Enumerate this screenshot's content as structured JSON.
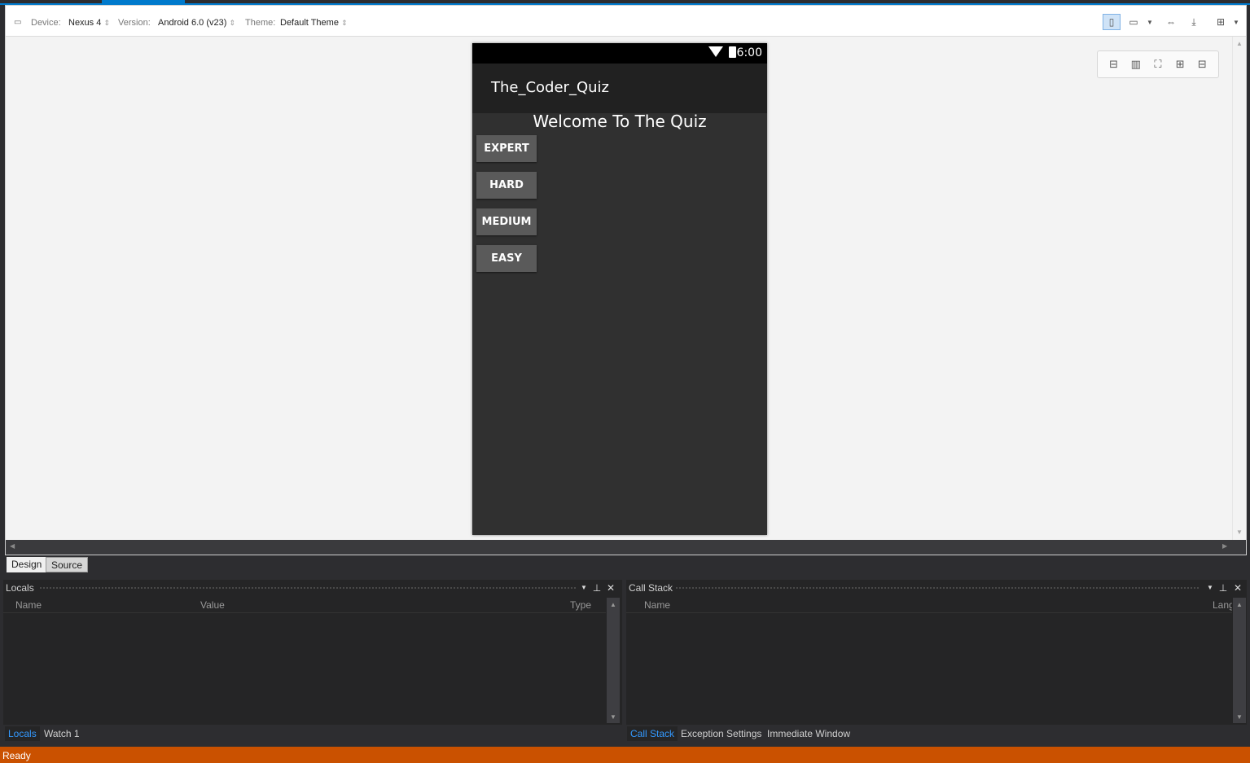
{
  "toolbar": {
    "device_label": "Device:",
    "device_value": "Nexus 4",
    "version_label": "Version:",
    "version_value": "Android 6.0 (v23)",
    "theme_label": "Theme:",
    "theme_value": "Default Theme"
  },
  "phone": {
    "time": "6:00",
    "app_title": "The_Coder_Quiz",
    "welcome": "Welcome To The Quiz",
    "buttons": [
      "EXPERT",
      "HARD",
      "MEDIUM",
      "EASY"
    ]
  },
  "design_tabs": {
    "design": "Design",
    "source": "Source"
  },
  "locals": {
    "title": "Locals",
    "columns": [
      "Name",
      "Value",
      "Type"
    ],
    "tabs": [
      "Locals",
      "Watch 1"
    ]
  },
  "callstack": {
    "title": "Call Stack",
    "columns": [
      "Name",
      "Lang"
    ],
    "tabs": [
      "Call Stack",
      "Exception Settings",
      "Immediate Window"
    ]
  },
  "status": "Ready",
  "colors": {
    "accent": "#007acc",
    "status_bar": "#ca5100",
    "active_tab_text": "#3399ff"
  }
}
